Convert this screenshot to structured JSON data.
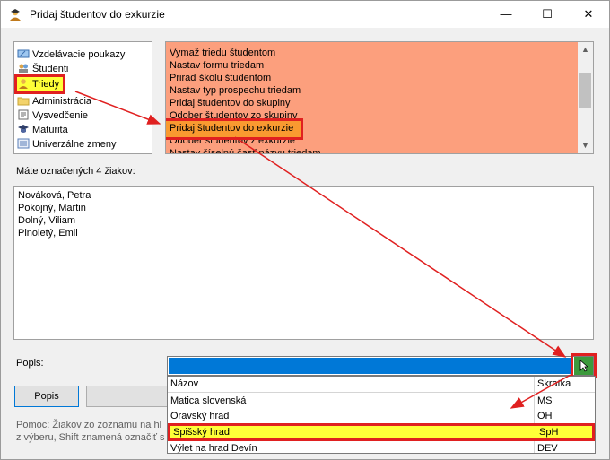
{
  "window": {
    "title": "Pridaj študentov do exkurzie",
    "icon": "students-hat-icon",
    "controls": {
      "minimize": "—",
      "maximize": "☐",
      "close": "✕"
    }
  },
  "tree": {
    "items": [
      {
        "label": "Vzdelávacie poukazy",
        "icon": "voucher-icon"
      },
      {
        "label": "Študenti",
        "icon": "students-icon"
      },
      {
        "label": "Triedy",
        "icon": "class-icon",
        "selected": true
      },
      {
        "label": "Administrácia",
        "icon": "folder-icon"
      },
      {
        "label": "Vysvedčenie",
        "icon": "report-card-icon"
      },
      {
        "label": "Maturita",
        "icon": "graduation-icon"
      },
      {
        "label": "Univerzálne zmeny",
        "icon": "list-icon"
      }
    ]
  },
  "operations": {
    "items": [
      "Vymaž triedu študentom",
      "Nastav formu triedam",
      "Priraď školu študentom",
      "Nastav typ prospechu triedam",
      "Pridaj študentov do skupiny",
      "Odober študentov zo skupiny",
      "Pridaj študentov do exkurzie",
      "Odober študentov z exkurzie",
      "Nastav číselnú časť názvu triedam"
    ],
    "selected_index": 6,
    "background": "#fc9f7d"
  },
  "students": {
    "count_label": "Máte označených 4 žiakov:",
    "items": [
      "Nováková, Petra",
      "Pokojný, Martin",
      "Dolný, Viliam",
      "Plnoletý, Emil"
    ]
  },
  "popis": {
    "label": "Popis:",
    "button": "Popis"
  },
  "help": {
    "line1": "Pomoc: Žiakov zo zoznamu na hl",
    "line2": "z výberu, Shift znamená označiť s"
  },
  "dropdown": {
    "headers": {
      "name": "Názov",
      "abbr": "Skratka"
    },
    "rows": [
      {
        "name": "Matica slovenská",
        "abbr": "MS"
      },
      {
        "name": "Oravský hrad",
        "abbr": "OH"
      },
      {
        "name": "Spišský hrad",
        "abbr": "SpH",
        "selected": true
      },
      {
        "name": "Výlet na hrad Devín",
        "abbr": "DEV"
      }
    ]
  },
  "colors": {
    "highlight": "#ffff38",
    "annotation": "#e02020",
    "selection_blue": "#0078d7"
  }
}
